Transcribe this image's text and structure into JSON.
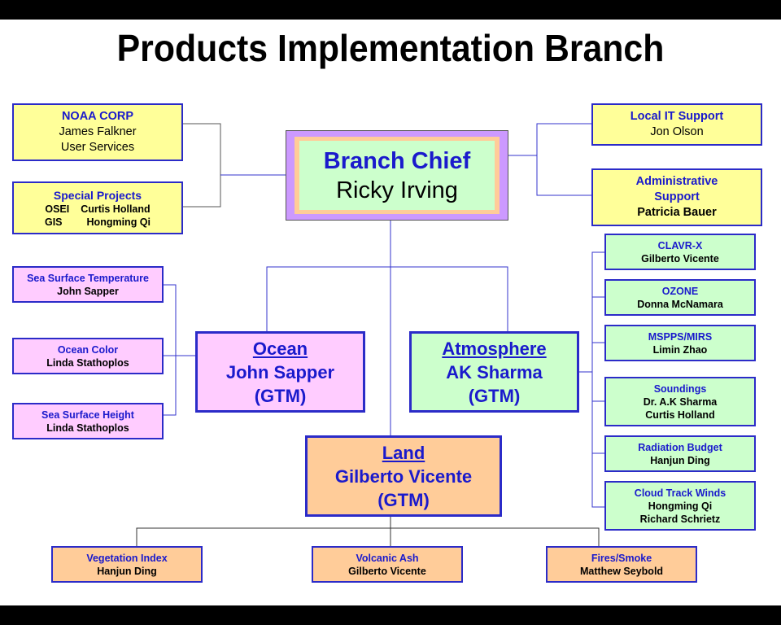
{
  "title": "Products Implementation Branch",
  "colors": {
    "heading_text": "#1a1acc",
    "box_border": "#2b2bc8",
    "support_fill": "#ffff99",
    "ocean_fill": "#ffccff",
    "atmosphere_fill": "#ccffcc",
    "land_fill": "#ffcc99",
    "chief_outer": "#cc99ff"
  },
  "chief": {
    "heading": "Branch Chief",
    "name": "Ricky Irving"
  },
  "support_left": [
    {
      "heading": "NOAA CORP",
      "lines": [
        "James Falkner",
        "User Services"
      ]
    },
    {
      "heading": "Special Projects",
      "rows": [
        {
          "code": "OSEI",
          "name": "Curtis Holland"
        },
        {
          "code": "GIS",
          "name": "Hongming Qi"
        }
      ]
    }
  ],
  "support_right": [
    {
      "heading": "Local IT Support",
      "lines": [
        "Jon Olson"
      ]
    },
    {
      "heading": "Administrative Support",
      "heading_lines": [
        "Administrative",
        "Support"
      ],
      "lines": [
        "Patricia Bauer"
      ]
    }
  ],
  "divisions": {
    "ocean": {
      "heading": "Ocean",
      "name": "John Sapper",
      "role": "(GTM)"
    },
    "atmosphere": {
      "heading": "Atmosphere",
      "name": "AK Sharma",
      "role": "(GTM)"
    },
    "land": {
      "heading": "Land",
      "name": "Gilberto Vicente",
      "role": "(GTM)"
    }
  },
  "ocean_teams": [
    {
      "heading": "Sea Surface Temperature",
      "lines": [
        "John Sapper"
      ]
    },
    {
      "heading": "Ocean Color",
      "lines": [
        "Linda Stathoplos"
      ]
    },
    {
      "heading": "Sea Surface Height",
      "lines": [
        "Linda Stathoplos"
      ]
    }
  ],
  "atmosphere_teams": [
    {
      "heading": "CLAVR-X",
      "lines": [
        "Gilberto Vicente"
      ]
    },
    {
      "heading": "OZONE",
      "lines": [
        "Donna McNamara"
      ]
    },
    {
      "heading": "MSPPS/MIRS",
      "lines": [
        "Limin Zhao"
      ]
    },
    {
      "heading": "Soundings",
      "lines": [
        "Dr. A.K Sharma",
        "Curtis Holland"
      ]
    },
    {
      "heading": "Radiation Budget",
      "lines": [
        "Hanjun Ding"
      ]
    },
    {
      "heading": "Cloud Track Winds",
      "lines": [
        "Hongming Qi",
        "Richard Schrietz"
      ]
    }
  ],
  "land_teams": [
    {
      "heading": "Vegetation Index",
      "lines": [
        "Hanjun Ding"
      ]
    },
    {
      "heading": "Volcanic Ash",
      "lines": [
        "Gilberto Vicente"
      ]
    },
    {
      "heading": "Fires/Smoke",
      "lines": [
        "Matthew Seybold"
      ]
    }
  ]
}
